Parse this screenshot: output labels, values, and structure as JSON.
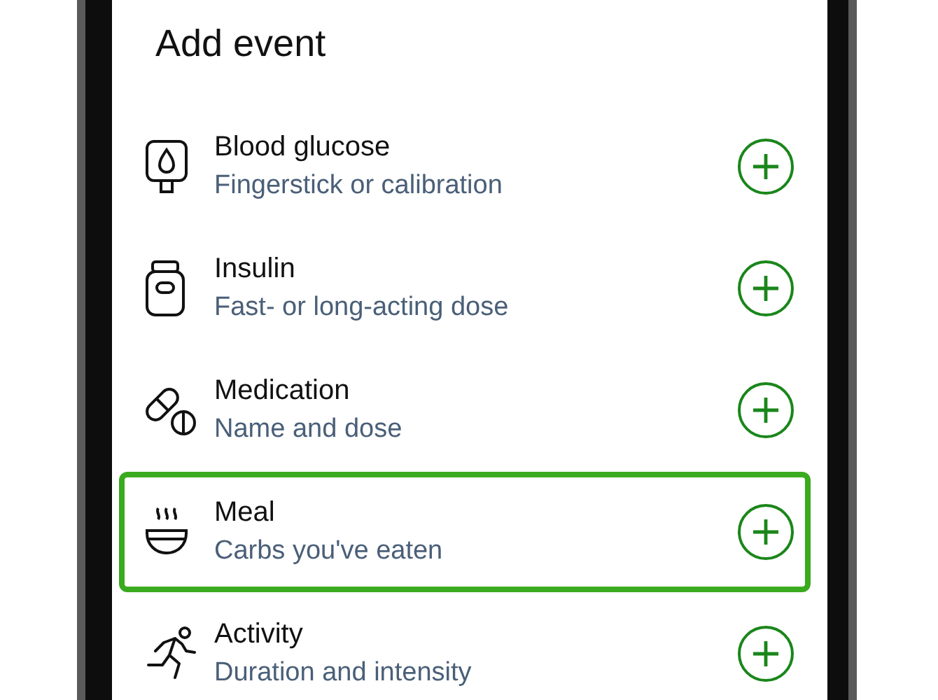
{
  "title": "Add event",
  "events": [
    {
      "name": "Blood glucose",
      "detail": "Fingerstick or calibration",
      "selected": false
    },
    {
      "name": "Insulin",
      "detail": "Fast- or long-acting dose",
      "selected": false
    },
    {
      "name": "Medication",
      "detail": "Name and dose",
      "selected": false
    },
    {
      "name": "Meal",
      "detail": "Carbs you've eaten",
      "selected": true
    },
    {
      "name": "Activity",
      "detail": "Duration and intensity",
      "selected": false
    }
  ]
}
